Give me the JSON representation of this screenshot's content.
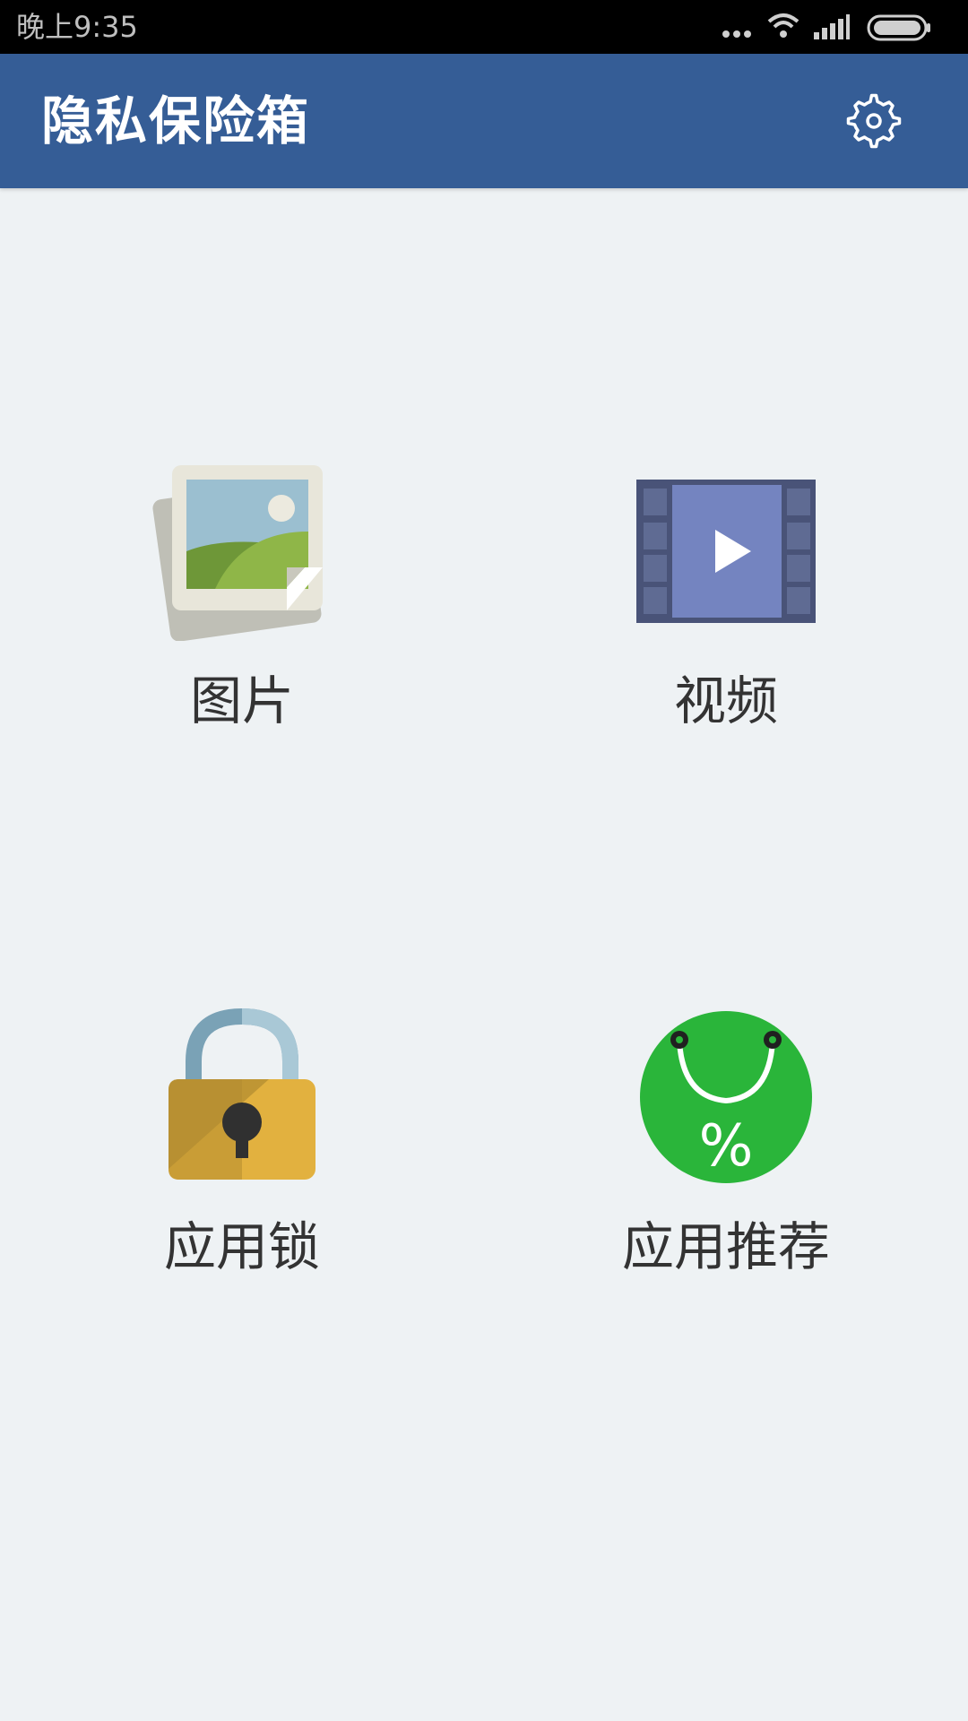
{
  "status_bar": {
    "time": "晚上9:35"
  },
  "app_bar": {
    "title": "隐私保险箱",
    "settings_icon": "gear-icon"
  },
  "tiles": [
    {
      "label": "图片",
      "icon": "photo-icon"
    },
    {
      "label": "视频",
      "icon": "video-icon"
    },
    {
      "label": "应用锁",
      "icon": "lock-icon"
    },
    {
      "label": "应用推荐",
      "icon": "shopping-bag-discount-icon"
    }
  ],
  "colors": {
    "app_bar": "#355d96",
    "background": "#eef2f4",
    "status_bar": "#000000",
    "label_text": "#333333"
  }
}
